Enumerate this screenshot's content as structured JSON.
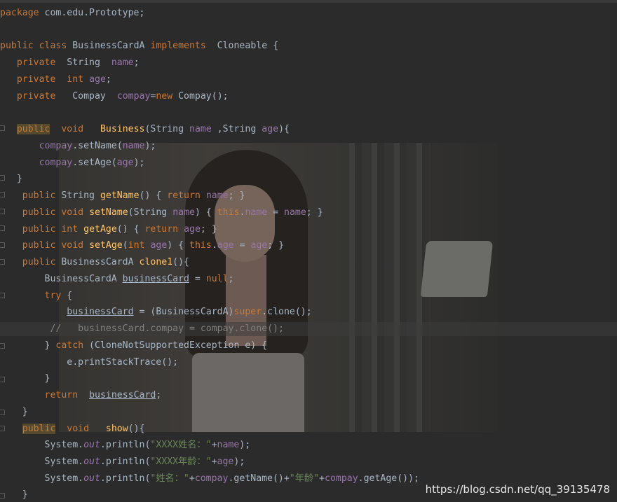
{
  "lines": [
    {
      "text": "package com.edu.Prototype;"
    },
    {
      "text": ""
    },
    {
      "text": "public class BusinessCardA implements  Cloneable {"
    },
    {
      "text": "   private  String  name;"
    },
    {
      "text": "   private  int age;"
    },
    {
      "text": "   private   Compay  compay=new Compay();"
    },
    {
      "text": ""
    },
    {
      "text": "   public  void   Business(String name ,String age){"
    },
    {
      "text": "       compay.setName(name);"
    },
    {
      "text": "       compay.setAge(age);"
    },
    {
      "text": "   }"
    },
    {
      "text": "    public String getName() { return name; }"
    },
    {
      "text": "    public void setName(String name) { this.name = name; }"
    },
    {
      "text": "    public int getAge() { return age; }"
    },
    {
      "text": "    public void setAge(int age) { this.age = age; }"
    },
    {
      "text": "    public BusinessCardA clone1(){"
    },
    {
      "text": "        BusinessCardA businessCard = null;"
    },
    {
      "text": "        try {"
    },
    {
      "text": "            businessCard = (BusinessCardA)super.clone();"
    },
    {
      "text": "         //   businessCard.compay = compay.clone();"
    },
    {
      "text": "        } catch (CloneNotSupportedException e) {"
    },
    {
      "text": "            e.printStackTrace();"
    },
    {
      "text": "        }"
    },
    {
      "text": "        return  businessCard;"
    },
    {
      "text": "    }"
    },
    {
      "text": "    public  void   show(){"
    },
    {
      "text": "        System.out.println(\"XXXX姓名：\"+name);"
    },
    {
      "text": "        System.out.println(\"XXXX年龄：\"+age);"
    },
    {
      "text": "        System.out.println(\"姓名：\"+compay.getName()+\"年龄\"+compay.getAge());"
    },
    {
      "text": "    }"
    }
  ],
  "watermark": "https://blog.csdn.net/qq_39135478"
}
